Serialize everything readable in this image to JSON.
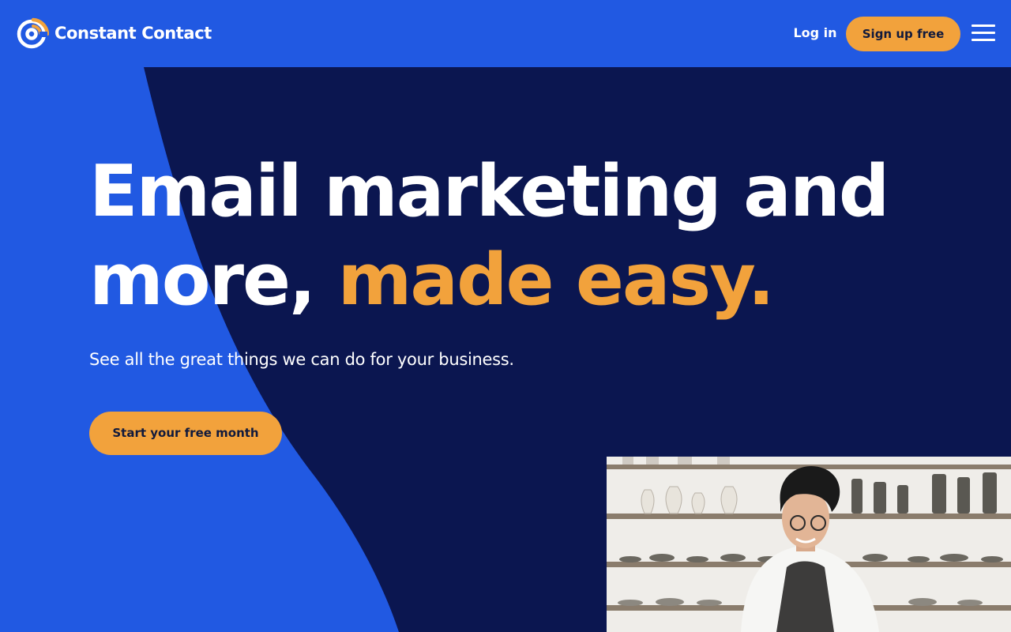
{
  "brand": {
    "name": "Constant Contact",
    "logo_icon": "constant-contact-logo-icon",
    "colors": {
      "header_blue": "#2159e2",
      "navy": "#0b1650",
      "orange": "#f2a23c",
      "dark_text": "#111a3c"
    }
  },
  "header": {
    "login_label": "Log in",
    "signup_label": "Sign up free",
    "menu_icon": "hamburger-menu-icon"
  },
  "hero": {
    "headline_line1": "Email marketing and",
    "headline_line2_plain": "more, ",
    "headline_line2_accent": "made easy.",
    "subhead": "See all the great things we can do for your business.",
    "cta_label": "Start your free month",
    "photo": "photo of smiling person in apron in front of shelves with ceramic pottery"
  }
}
